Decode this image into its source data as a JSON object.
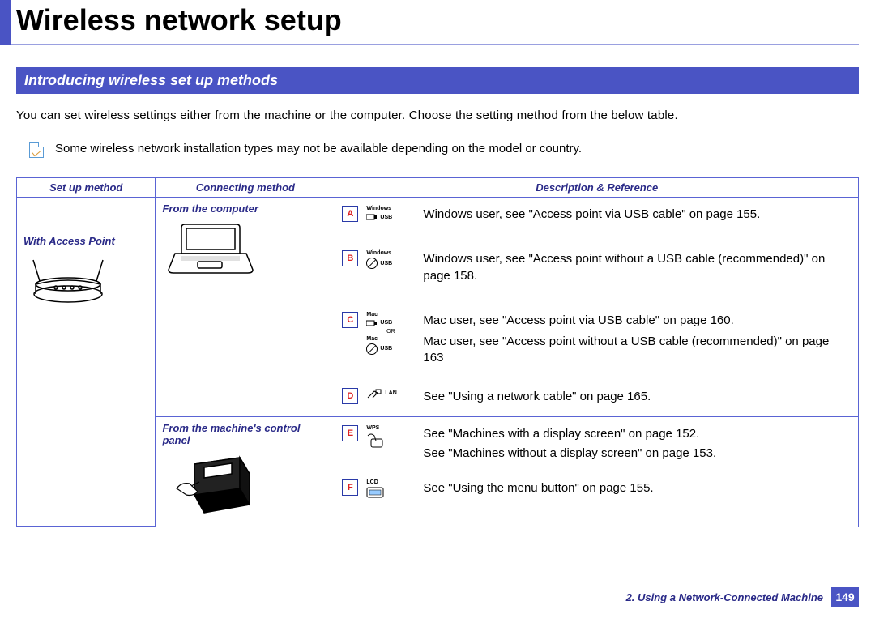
{
  "page_title": "Wireless network setup",
  "section_heading": "Introducing wireless set up methods",
  "intro_text": "You can set wireless settings either from the machine or the computer. Choose the setting method from the below table.",
  "note_text": "Some wireless network installation types may not be available depending on the model or country.",
  "table": {
    "headers": {
      "setup": "Set up method",
      "connecting": "Connecting method",
      "description": "Description & Reference"
    },
    "setup_label": "With Access Point",
    "connecting": {
      "from_computer": "From the computer",
      "from_panel": "From the machine's control panel"
    },
    "rows": {
      "A": {
        "os": "Windows",
        "conn": "USB",
        "text": "Windows user, see \"Access point via USB cable\" on page 155."
      },
      "B": {
        "os": "Windows",
        "conn": "no-USB",
        "text": "Windows user, see \"Access point without a USB cable (recommended)\" on page 158."
      },
      "C": {
        "os": "Mac",
        "conn": "USB-or-noUSB",
        "text1": "Mac user, see \"Access point via USB cable\" on page 160.",
        "text2": "Mac user, see \"Access point without a USB cable (recommended)\" on page 163"
      },
      "D": {
        "conn": "LAN",
        "text": "See \"Using a network cable\" on page 165."
      },
      "E": {
        "conn": "WPS",
        "text1": "See \"Machines with a display screen\" on page 152.",
        "text2": "See \"Machines without a display screen\" on page 153."
      },
      "F": {
        "conn": "LCD",
        "text": "See \"Using the menu button\" on page 155."
      }
    }
  },
  "footer": {
    "chapter": "2.  Using a Network-Connected Machine",
    "page": "149"
  },
  "icons": {
    "or_label": "OR",
    "usb_label": "USB",
    "lan_label": "LAN",
    "wps_label": "WPS",
    "lcd_label": "LCD"
  }
}
